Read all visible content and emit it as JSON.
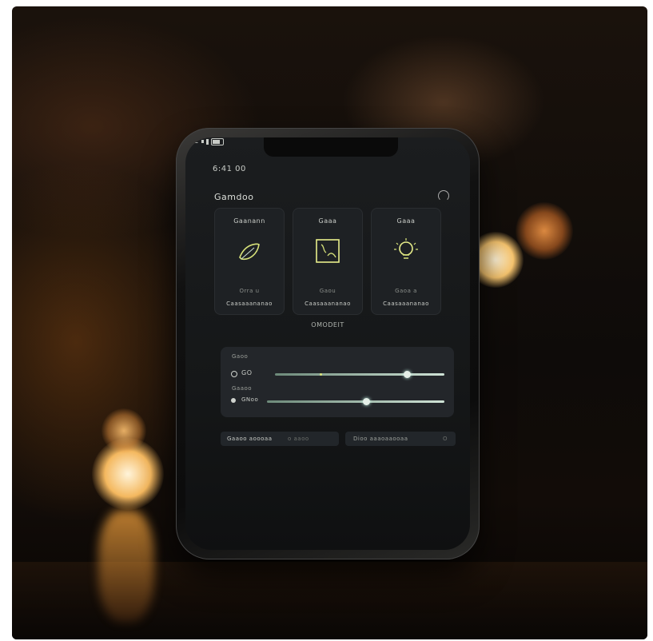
{
  "status_bar": {
    "time": "6:41 00",
    "signal": "◀ 2"
  },
  "header": {
    "title": "Gamdoo"
  },
  "cards": [
    {
      "name": "Gaanann",
      "state": "Orra u",
      "sub": "Caasaaananao",
      "icon": "leaf-icon"
    },
    {
      "name": "Gaaa",
      "state": "Gaou",
      "sub": "Caasaaananao",
      "icon": "frame-icon"
    },
    {
      "name": "Gaaa",
      "state": "Gaoa a",
      "sub": "Caasaaananao",
      "icon": "bulb-icon"
    }
  ],
  "center_label": "OMODEIT",
  "sliders": {
    "group_label": "Gaoo",
    "row1": {
      "label": "GO",
      "value": 0.78
    },
    "sub_label": "Gaaoo",
    "row2": {
      "label": "GNoo",
      "value": 0.56
    }
  },
  "chips": [
    {
      "label": "Gaaoo aoooaa",
      "extra": "o aaoo"
    },
    {
      "label": "Dioo aaaoaaooaa",
      "extra": "O"
    }
  ],
  "colors": {
    "accent": "#d7e27a",
    "slider": "#cfe3d6",
    "screen_bg": "#1b1d1f"
  }
}
